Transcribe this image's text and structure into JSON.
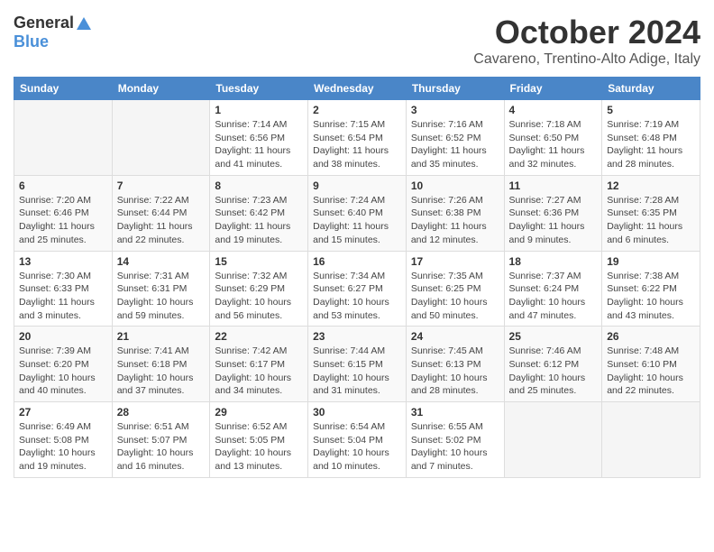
{
  "header": {
    "logo_general": "General",
    "logo_blue": "Blue",
    "month_title": "October 2024",
    "subtitle": "Cavareno, Trentino-Alto Adige, Italy"
  },
  "weekdays": [
    "Sunday",
    "Monday",
    "Tuesday",
    "Wednesday",
    "Thursday",
    "Friday",
    "Saturday"
  ],
  "weeks": [
    [
      {
        "day": "",
        "sunrise": "",
        "sunset": "",
        "daylight": ""
      },
      {
        "day": "",
        "sunrise": "",
        "sunset": "",
        "daylight": ""
      },
      {
        "day": "1",
        "sunrise": "Sunrise: 7:14 AM",
        "sunset": "Sunset: 6:56 PM",
        "daylight": "Daylight: 11 hours and 41 minutes."
      },
      {
        "day": "2",
        "sunrise": "Sunrise: 7:15 AM",
        "sunset": "Sunset: 6:54 PM",
        "daylight": "Daylight: 11 hours and 38 minutes."
      },
      {
        "day": "3",
        "sunrise": "Sunrise: 7:16 AM",
        "sunset": "Sunset: 6:52 PM",
        "daylight": "Daylight: 11 hours and 35 minutes."
      },
      {
        "day": "4",
        "sunrise": "Sunrise: 7:18 AM",
        "sunset": "Sunset: 6:50 PM",
        "daylight": "Daylight: 11 hours and 32 minutes."
      },
      {
        "day": "5",
        "sunrise": "Sunrise: 7:19 AM",
        "sunset": "Sunset: 6:48 PM",
        "daylight": "Daylight: 11 hours and 28 minutes."
      }
    ],
    [
      {
        "day": "6",
        "sunrise": "Sunrise: 7:20 AM",
        "sunset": "Sunset: 6:46 PM",
        "daylight": "Daylight: 11 hours and 25 minutes."
      },
      {
        "day": "7",
        "sunrise": "Sunrise: 7:22 AM",
        "sunset": "Sunset: 6:44 PM",
        "daylight": "Daylight: 11 hours and 22 minutes."
      },
      {
        "day": "8",
        "sunrise": "Sunrise: 7:23 AM",
        "sunset": "Sunset: 6:42 PM",
        "daylight": "Daylight: 11 hours and 19 minutes."
      },
      {
        "day": "9",
        "sunrise": "Sunrise: 7:24 AM",
        "sunset": "Sunset: 6:40 PM",
        "daylight": "Daylight: 11 hours and 15 minutes."
      },
      {
        "day": "10",
        "sunrise": "Sunrise: 7:26 AM",
        "sunset": "Sunset: 6:38 PM",
        "daylight": "Daylight: 11 hours and 12 minutes."
      },
      {
        "day": "11",
        "sunrise": "Sunrise: 7:27 AM",
        "sunset": "Sunset: 6:36 PM",
        "daylight": "Daylight: 11 hours and 9 minutes."
      },
      {
        "day": "12",
        "sunrise": "Sunrise: 7:28 AM",
        "sunset": "Sunset: 6:35 PM",
        "daylight": "Daylight: 11 hours and 6 minutes."
      }
    ],
    [
      {
        "day": "13",
        "sunrise": "Sunrise: 7:30 AM",
        "sunset": "Sunset: 6:33 PM",
        "daylight": "Daylight: 11 hours and 3 minutes."
      },
      {
        "day": "14",
        "sunrise": "Sunrise: 7:31 AM",
        "sunset": "Sunset: 6:31 PM",
        "daylight": "Daylight: 10 hours and 59 minutes."
      },
      {
        "day": "15",
        "sunrise": "Sunrise: 7:32 AM",
        "sunset": "Sunset: 6:29 PM",
        "daylight": "Daylight: 10 hours and 56 minutes."
      },
      {
        "day": "16",
        "sunrise": "Sunrise: 7:34 AM",
        "sunset": "Sunset: 6:27 PM",
        "daylight": "Daylight: 10 hours and 53 minutes."
      },
      {
        "day": "17",
        "sunrise": "Sunrise: 7:35 AM",
        "sunset": "Sunset: 6:25 PM",
        "daylight": "Daylight: 10 hours and 50 minutes."
      },
      {
        "day": "18",
        "sunrise": "Sunrise: 7:37 AM",
        "sunset": "Sunset: 6:24 PM",
        "daylight": "Daylight: 10 hours and 47 minutes."
      },
      {
        "day": "19",
        "sunrise": "Sunrise: 7:38 AM",
        "sunset": "Sunset: 6:22 PM",
        "daylight": "Daylight: 10 hours and 43 minutes."
      }
    ],
    [
      {
        "day": "20",
        "sunrise": "Sunrise: 7:39 AM",
        "sunset": "Sunset: 6:20 PM",
        "daylight": "Daylight: 10 hours and 40 minutes."
      },
      {
        "day": "21",
        "sunrise": "Sunrise: 7:41 AM",
        "sunset": "Sunset: 6:18 PM",
        "daylight": "Daylight: 10 hours and 37 minutes."
      },
      {
        "day": "22",
        "sunrise": "Sunrise: 7:42 AM",
        "sunset": "Sunset: 6:17 PM",
        "daylight": "Daylight: 10 hours and 34 minutes."
      },
      {
        "day": "23",
        "sunrise": "Sunrise: 7:44 AM",
        "sunset": "Sunset: 6:15 PM",
        "daylight": "Daylight: 10 hours and 31 minutes."
      },
      {
        "day": "24",
        "sunrise": "Sunrise: 7:45 AM",
        "sunset": "Sunset: 6:13 PM",
        "daylight": "Daylight: 10 hours and 28 minutes."
      },
      {
        "day": "25",
        "sunrise": "Sunrise: 7:46 AM",
        "sunset": "Sunset: 6:12 PM",
        "daylight": "Daylight: 10 hours and 25 minutes."
      },
      {
        "day": "26",
        "sunrise": "Sunrise: 7:48 AM",
        "sunset": "Sunset: 6:10 PM",
        "daylight": "Daylight: 10 hours and 22 minutes."
      }
    ],
    [
      {
        "day": "27",
        "sunrise": "Sunrise: 6:49 AM",
        "sunset": "Sunset: 5:08 PM",
        "daylight": "Daylight: 10 hours and 19 minutes."
      },
      {
        "day": "28",
        "sunrise": "Sunrise: 6:51 AM",
        "sunset": "Sunset: 5:07 PM",
        "daylight": "Daylight: 10 hours and 16 minutes."
      },
      {
        "day": "29",
        "sunrise": "Sunrise: 6:52 AM",
        "sunset": "Sunset: 5:05 PM",
        "daylight": "Daylight: 10 hours and 13 minutes."
      },
      {
        "day": "30",
        "sunrise": "Sunrise: 6:54 AM",
        "sunset": "Sunset: 5:04 PM",
        "daylight": "Daylight: 10 hours and 10 minutes."
      },
      {
        "day": "31",
        "sunrise": "Sunrise: 6:55 AM",
        "sunset": "Sunset: 5:02 PM",
        "daylight": "Daylight: 10 hours and 7 minutes."
      },
      {
        "day": "",
        "sunrise": "",
        "sunset": "",
        "daylight": ""
      },
      {
        "day": "",
        "sunrise": "",
        "sunset": "",
        "daylight": ""
      }
    ]
  ]
}
